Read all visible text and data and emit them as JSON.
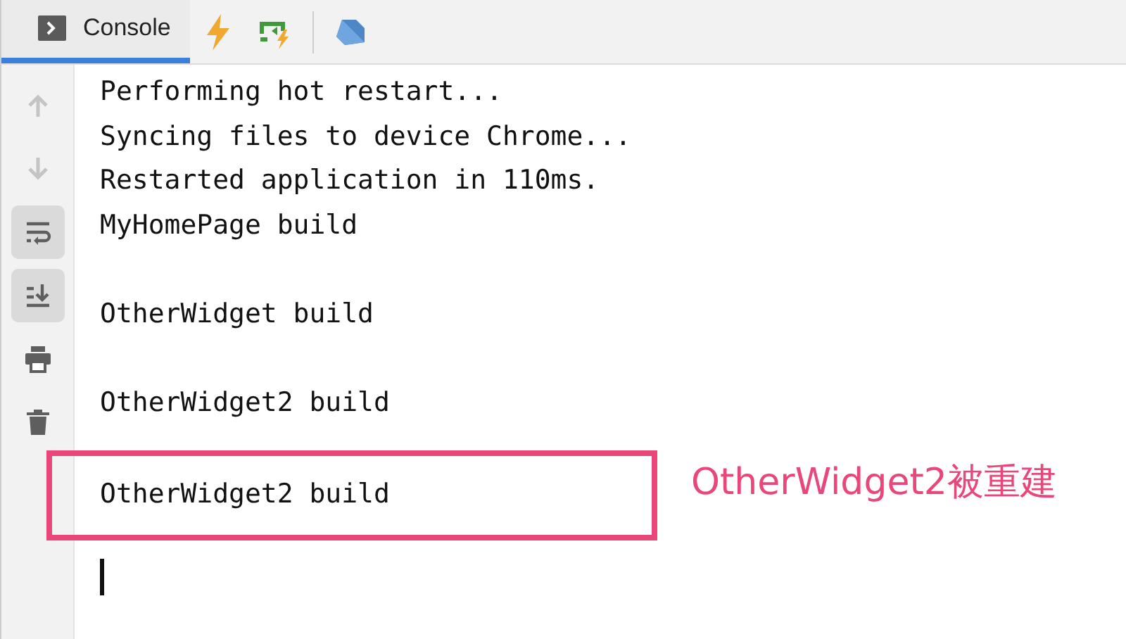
{
  "tabs": [
    {
      "label": "Console",
      "selected": true
    }
  ],
  "toolbar": [
    {
      "kind": "up",
      "disabled": true,
      "on": false
    },
    {
      "kind": "down",
      "disabled": true,
      "on": false
    },
    {
      "kind": "wrap",
      "disabled": false,
      "on": true
    },
    {
      "kind": "scroll",
      "disabled": false,
      "on": true
    },
    {
      "kind": "print",
      "disabled": false,
      "on": false
    },
    {
      "kind": "trash",
      "disabled": false,
      "on": false
    }
  ],
  "console_lines": [
    {
      "text": "Performing hot restart...",
      "spaced": false,
      "highlighted": false
    },
    {
      "text": "Syncing files to device Chrome...",
      "spaced": false,
      "highlighted": false
    },
    {
      "text": "Restarted application in 110ms.",
      "spaced": false,
      "highlighted": false
    },
    {
      "text": "MyHomePage build",
      "spaced": false,
      "highlighted": false
    },
    {
      "text": "OtherWidget build",
      "spaced": true,
      "highlighted": false
    },
    {
      "text": "OtherWidget2 build",
      "spaced": true,
      "highlighted": false
    },
    {
      "text": "OtherWidget2 build",
      "spaced": true,
      "highlighted": true
    }
  ],
  "annotation": "OtherWidget2被重建"
}
